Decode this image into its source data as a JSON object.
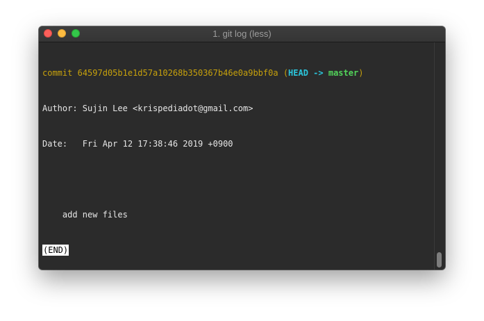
{
  "window": {
    "title": "1. git log (less)"
  },
  "terminal": {
    "commit_label": "commit",
    "commit_hash": "64597d05b1e1d57a10268b350367b46e0a9bbf0a",
    "ref_open": "(",
    "head_ref": "HEAD ->",
    "branch": "master",
    "ref_close": ")",
    "author_line": "Author: Sujin Lee <krispediadot@gmail.com>",
    "date_line": "Date:   Fri Apr 12 17:38:46 2019 +0900",
    "message_line": "    add new files",
    "end_marker": "(END)"
  },
  "scrollbar": {
    "position": 1.0
  },
  "colors": {
    "commit": "#c7a10c",
    "head": "#2bc6dc",
    "branch": "#52d35a",
    "background": "#2b2b2b",
    "text": "#e6e6e6"
  }
}
